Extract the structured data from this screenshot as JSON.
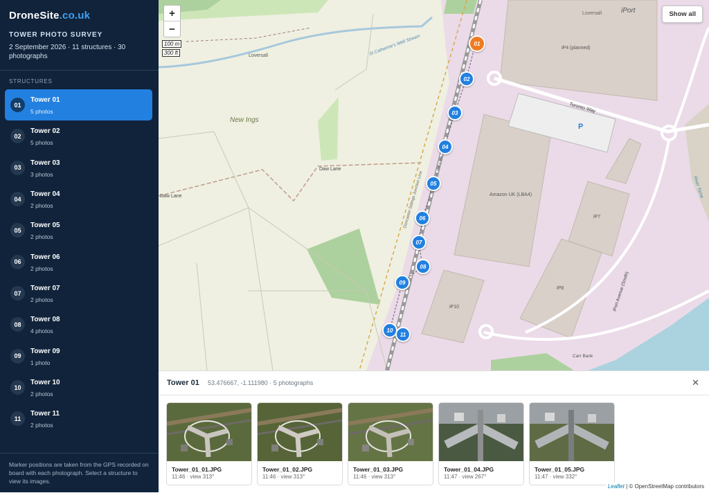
{
  "brand": {
    "name": "DroneSite",
    "domain": ".co.uk"
  },
  "survey": {
    "title": "TOWER PHOTO SURVEY",
    "meta": "2 September 2026 · 11 structures · 30 photographs"
  },
  "sidebar": {
    "section_label": "STRUCTURES",
    "structures": [
      {
        "num": "01",
        "name": "Tower 01",
        "count": "5 photos"
      },
      {
        "num": "02",
        "name": "Tower 02",
        "count": "5 photos"
      },
      {
        "num": "03",
        "name": "Tower 03",
        "count": "3 photos"
      },
      {
        "num": "04",
        "name": "Tower 04",
        "count": "2 photos"
      },
      {
        "num": "05",
        "name": "Tower 05",
        "count": "2 photos"
      },
      {
        "num": "06",
        "name": "Tower 06",
        "count": "2 photos"
      },
      {
        "num": "07",
        "name": "Tower 07",
        "count": "2 photos"
      },
      {
        "num": "08",
        "name": "Tower 08",
        "count": "4 photos"
      },
      {
        "num": "09",
        "name": "Tower 09",
        "count": "1 photo"
      },
      {
        "num": "10",
        "name": "Tower 10",
        "count": "2 photos"
      },
      {
        "num": "11",
        "name": "Tower 11",
        "count": "2 photos"
      }
    ],
    "active_index": 0,
    "footnote": "Marker positions are taken from the GPS recorded on board with each photograph. Select a structure to view its images."
  },
  "map": {
    "zoom_in": "+",
    "zoom_out": "−",
    "scale_metric": "100 m",
    "scale_imperial": "300 ft",
    "show_all": "Show all",
    "labels": {
      "loversall_1": "Loversall",
      "loversall_2": "Loversall",
      "stream": "St Catherine's Well Stream",
      "new_ings": "New Ings",
      "daw_lane_1": "Daw Lane",
      "daw_lane_2": "Daw Lane",
      "railway": "Doncaster Sidings Junction Line",
      "iport": "iPort",
      "ip4": "iP4 (planned)",
      "toronto_way": "Toronto Way",
      "parking": "P",
      "amazon": "Amazon UK (LBA4)",
      "ip7": "iP7",
      "ip8": "iP8",
      "ip10": "iP10",
      "iport_avenue": "iPort Avenue (South)",
      "river_torne": "River Torne",
      "carr_bank": "Carr Bank"
    },
    "markers": [
      "01",
      "02",
      "03",
      "04",
      "05",
      "06",
      "07",
      "08",
      "09",
      "10",
      "11"
    ],
    "attribution_leaflet": "Leaflet",
    "attribution_osm": "© OpenStreetMap contributors",
    "colors": {
      "marker": "#2280e0",
      "marker_active": "#f07b22",
      "industrial": "#ebdbe8",
      "building": "#d9d0c9",
      "field": "#eff0e1"
    }
  },
  "panel": {
    "title": "Tower 01",
    "meta": "53.476667, -1.111980 · 5 photographs",
    "close": "✕",
    "photos": [
      {
        "file": "Tower_01_01.JPG",
        "info": "11:46 · view 313°"
      },
      {
        "file": "Tower_01_02.JPG",
        "info": "11:46 · view 313°"
      },
      {
        "file": "Tower_01_03.JPG",
        "info": "11:46 · view 313°"
      },
      {
        "file": "Tower_01_04.JPG",
        "info": "11:47 · view 267°"
      },
      {
        "file": "Tower_01_05.JPG",
        "info": "11:47 · view 332°"
      }
    ]
  }
}
